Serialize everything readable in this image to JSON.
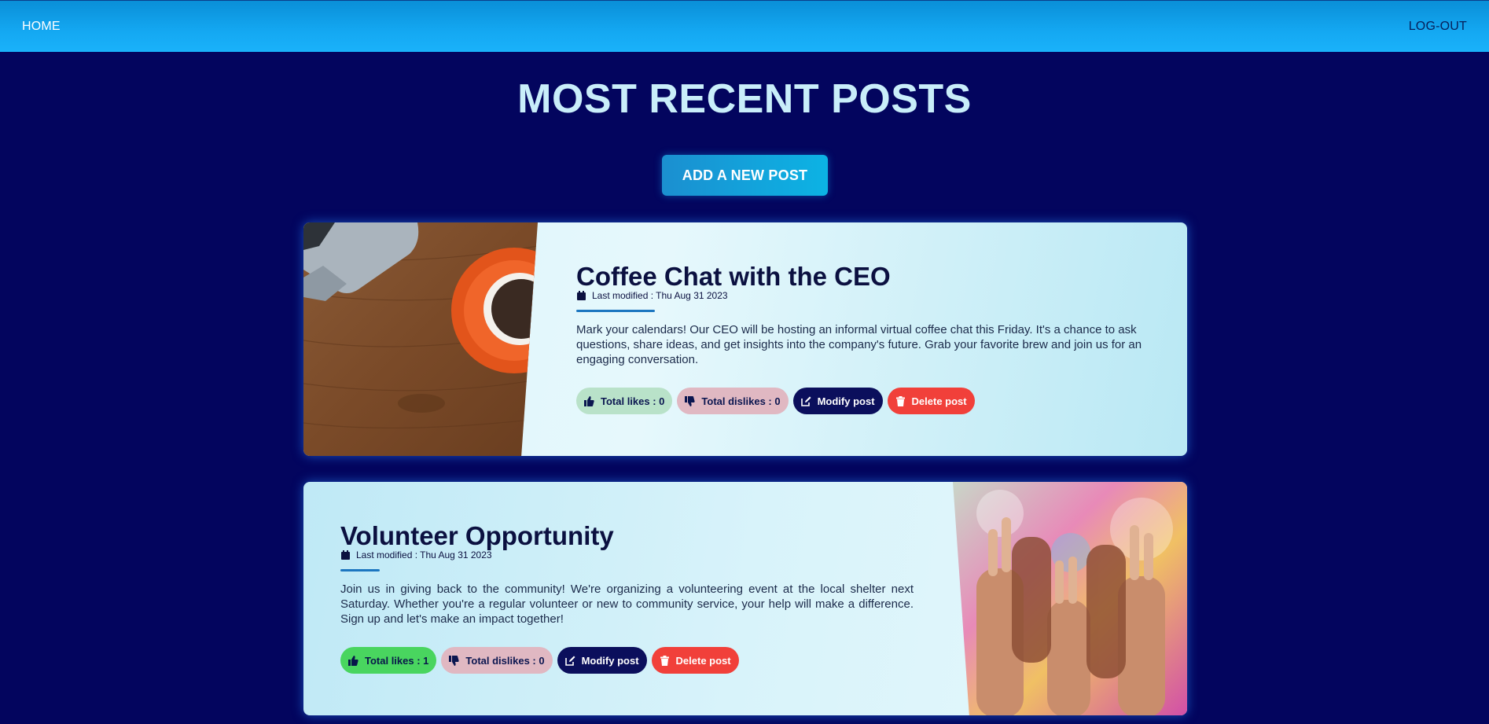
{
  "nav": {
    "home": "HOME",
    "logout": "LOG-OUT"
  },
  "page": {
    "title": "MOST RECENT POSTS",
    "add_button": "ADD A NEW POST"
  },
  "posts": [
    {
      "title": "Coffee Chat with the CEO",
      "meta": "Last modified : Thu Aug 31 2023",
      "body": "Mark your calendars! Our CEO will be hosting an informal virtual coffee chat this Friday. It's a chance to ask questions, share ideas, and get insights into the company's future. Grab your favorite brew and join us for an engaging conversation.",
      "likes_label": "Total likes : 0",
      "dislikes_label": "Total dislikes : 0",
      "modify_label": "Modify post",
      "delete_label": "Delete post",
      "image": "laptop-and-coffee-cup-photo"
    },
    {
      "title": "Volunteer Opportunity",
      "meta": "Last modified : Thu Aug 31 2023",
      "body": "Join us in giving back to the community! We're organizing a volunteering event at the local shelter next Saturday. Whether you're a regular volunteer or new to community service, your help will make a difference. Sign up and let's make an impact together!",
      "likes_label": "Total likes : 1",
      "dislikes_label": "Total dislikes : 0",
      "modify_label": "Modify post",
      "delete_label": "Delete post",
      "image": "raised-hands-photo"
    }
  ],
  "icons": {
    "calendar": "calendar-icon",
    "like": "thumbs-up-icon",
    "dislike": "thumbs-down-icon",
    "modify": "edit-icon",
    "delete": "trash-icon"
  },
  "colors": {
    "background": "#03055e",
    "navbar": "#14a8f2",
    "title": "#c9eefa",
    "like_active": "#49d55f",
    "modify": "#0b0f5c",
    "delete": "#f1403a"
  }
}
